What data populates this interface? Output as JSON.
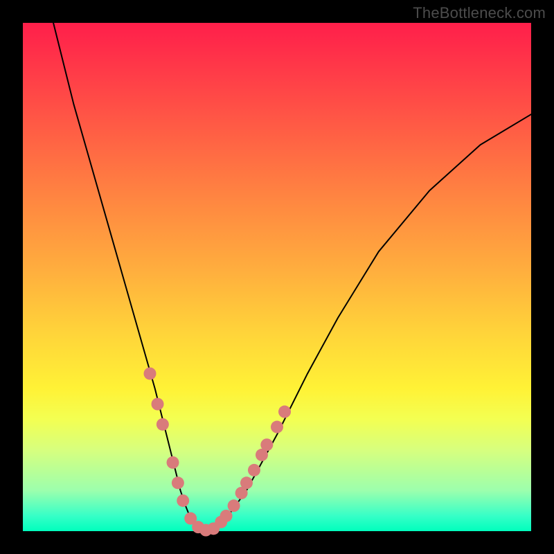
{
  "watermark": "TheBottleneck.com",
  "chart_data": {
    "type": "line",
    "title": "",
    "xlabel": "",
    "ylabel": "",
    "xlim": [
      0,
      100
    ],
    "ylim": [
      0,
      100
    ],
    "grid": false,
    "legend": false,
    "note": "Bottleneck-style V-curve. X is an unlabeled component ratio axis (0-100). Y is relative bottleneck magnitude (0 = optimal at bottom, 100 = worst at top). Values estimated from pixel positions; no axis ticks are shown in the source image.",
    "series": [
      {
        "name": "bottleneck-curve",
        "color": "#000000",
        "stroke_width": 2,
        "x": [
          6,
          8,
          10,
          12,
          14,
          16,
          18,
          20,
          22,
          24,
          26,
          27,
          28,
          29,
          30,
          31,
          32,
          33,
          34,
          35,
          36,
          38,
          40,
          44,
          50,
          56,
          62,
          70,
          80,
          90,
          100
        ],
        "y": [
          100,
          92,
          84,
          77,
          70,
          63,
          56,
          49,
          42,
          35,
          28,
          24,
          20,
          16,
          12,
          8,
          5,
          2.5,
          1,
          0.3,
          0,
          0.6,
          2.5,
          8,
          19,
          31,
          42,
          55,
          67,
          76,
          82
        ]
      }
    ],
    "markers": {
      "name": "highlight-dots",
      "color": "#d97b7b",
      "radius": 9,
      "note": "Salmon-colored sample dots clustered near the curve minimum on both branches.",
      "points": [
        {
          "x": 25.0,
          "y": 31.0
        },
        {
          "x": 26.5,
          "y": 25.0
        },
        {
          "x": 27.5,
          "y": 21.0
        },
        {
          "x": 29.5,
          "y": 13.5
        },
        {
          "x": 30.5,
          "y": 9.5
        },
        {
          "x": 31.5,
          "y": 6.0
        },
        {
          "x": 33.0,
          "y": 2.5
        },
        {
          "x": 34.5,
          "y": 0.8
        },
        {
          "x": 36.0,
          "y": 0.2
        },
        {
          "x": 37.5,
          "y": 0.5
        },
        {
          "x": 39.0,
          "y": 1.8
        },
        {
          "x": 40.0,
          "y": 3.0
        },
        {
          "x": 41.5,
          "y": 5.0
        },
        {
          "x": 43.0,
          "y": 7.5
        },
        {
          "x": 44.0,
          "y": 9.5
        },
        {
          "x": 45.5,
          "y": 12.0
        },
        {
          "x": 47.0,
          "y": 15.0
        },
        {
          "x": 48.0,
          "y": 17.0
        },
        {
          "x": 50.0,
          "y": 20.5
        },
        {
          "x": 51.5,
          "y": 23.5
        }
      ]
    }
  }
}
